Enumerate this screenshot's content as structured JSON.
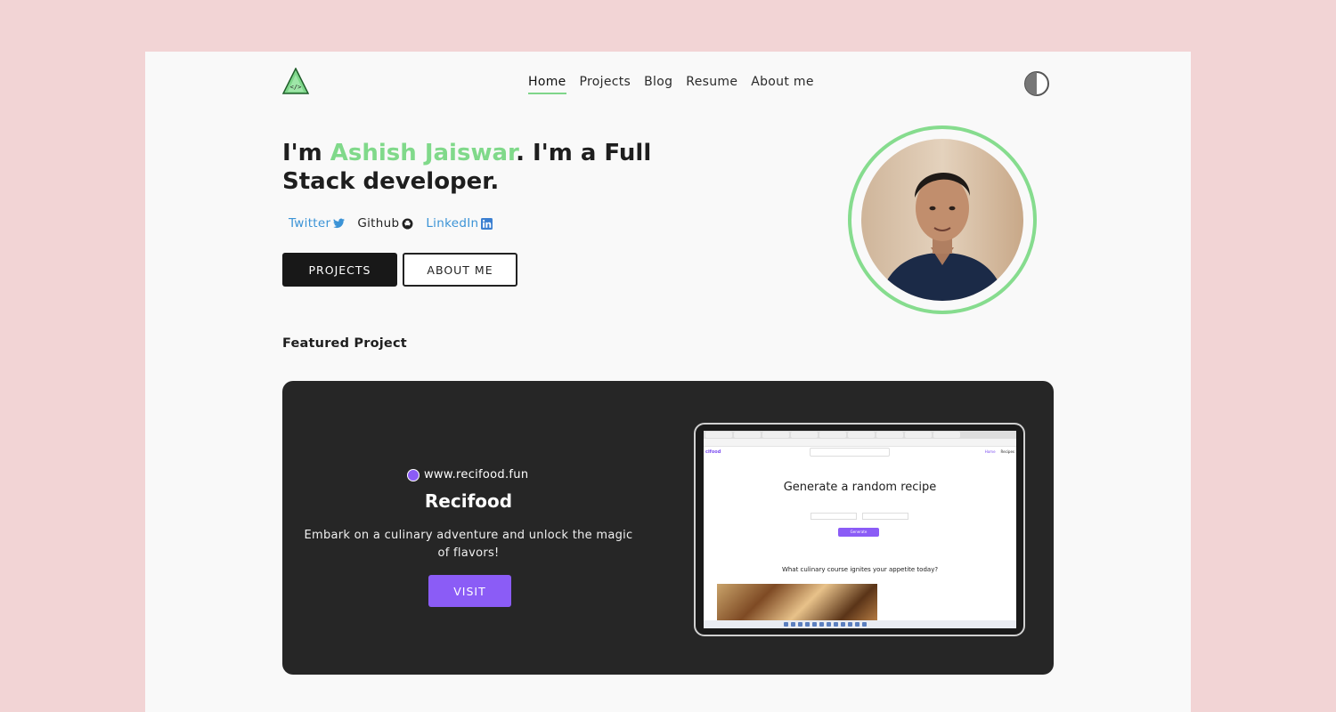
{
  "nav": {
    "items": [
      "Home",
      "Projects",
      "Blog",
      "Resume",
      "About me"
    ],
    "active": "Home"
  },
  "hero": {
    "title_prefix": "I'm ",
    "name": "Ashish Jaiswar",
    "title_suffix": ". I'm a Full Stack developer.",
    "socials": [
      {
        "label": "Twitter",
        "icon": "twitter-icon"
      },
      {
        "label": "Github",
        "icon": "github-icon"
      },
      {
        "label": "LinkedIn",
        "icon": "linkedin-icon"
      }
    ],
    "projects_button": "PROJECTS",
    "about_button": "ABOUT ME"
  },
  "featured": {
    "label": "Featured Project",
    "url": "www.recifood.fun",
    "name": "Recifood",
    "description": "Embark on a culinary adventure and unlock the magic of flavors!",
    "visit_button": "VISIT",
    "screenshot": {
      "heading": "Generate a random recipe",
      "question": "What culinary course ignites your appetite today?",
      "generate": "Generate"
    }
  },
  "colors": {
    "accent_green": "#80d98a",
    "link_blue": "#3b93d6",
    "brand_purple": "#8b5cf6",
    "card_bg": "#262626",
    "outer_bg": "#f2d4d5"
  }
}
